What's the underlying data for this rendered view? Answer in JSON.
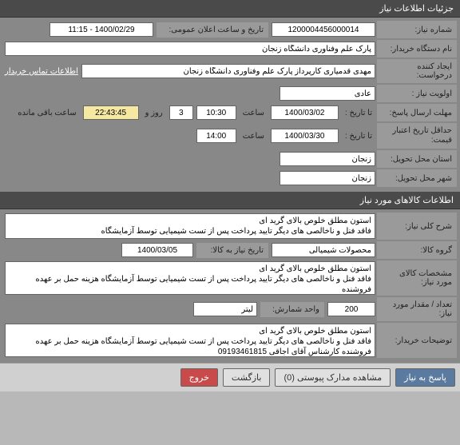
{
  "section1": {
    "header": "جزئیات اطلاعات نیاز",
    "rows": {
      "number_label": "شماره نیاز:",
      "number_value": "1200004456000014",
      "announce_label": "تاریخ و ساعت اعلان عمومی:",
      "announce_value": "1400/02/29 - 11:15",
      "buyer_label": "نام دستگاه خریدار:",
      "buyer_value": "پارک علم وفناوری دانشگاه زنجان",
      "creator_label": "ایجاد کننده درخواست:",
      "creator_value": "مهدی قدمیاری کارپرداز پارک علم وفناوری دانشگاه زنجان",
      "contact_link": "اطلاعات تماس خریدار",
      "priority_label": "اولویت نیاز :",
      "priority_value": "عادی",
      "deadline_label": "مهلت ارسال پاسخ:",
      "until_label": "تا تاریخ :",
      "until_date": "1400/03/02",
      "time_label": "ساعت",
      "until_time": "10:30",
      "days_value": "3",
      "days_label": "روز و",
      "remaining_time": "22:43:45",
      "remaining_label": "ساعت باقی مانده",
      "validity_label": "حداقل تاریخ اعتبار قیمت:",
      "validity_until_label": "تا تاریخ :",
      "validity_date": "1400/03/30",
      "validity_time": "14:00",
      "province_label": "استان محل تحویل:",
      "province_value": "زنجان",
      "city_label": "شهر محل تحویل:",
      "city_value": "زنجان"
    }
  },
  "section2": {
    "header": "اطلاعات کالاهای مورد نیاز",
    "rows": {
      "desc_label": "شرح کلی نیاز:",
      "desc_value": "استون مطلق خلوص بالای گرید ای\nفاقد فنل و ناخالصی های دیگر تایید پرداخت پس از تست شیمیایی توسط آزمایشگاه",
      "group_label": "گروه کالا:",
      "group_value": "محصولات شیمیالی",
      "group_date_label": "تاریخ نیاز به کالا:",
      "group_date_value": "1400/03/05",
      "spec_label": "مشخصات کالای مورد نیاز:",
      "spec_value": "استون مطلق خلوص بالای گرید ای\nفاقد فنل و ناخالصی های دیگر تایید پرداخت پس از تست شیمیایی توسط آزمایشگاه هزینه حمل بر عهده فروشنده",
      "qty_label": "تعداد / مقدار مورد نیاز:",
      "qty_value": "200",
      "unit_label": "واحد شمارش:",
      "unit_value": "لیتر",
      "notes_label": "توضیحات خریدار:",
      "notes_value": "استون مطلق خلوص بالای گرید ای\nفاقد فنل و ناخالصی های دیگر تایید پرداخت پس از تست شیمیایی توسط آزمایشگاه هزینه حمل بر عهده فروشنده کارشناس آقای اجاقی 09193461815"
    }
  },
  "footer": {
    "respond": "پاسخ به نیاز",
    "attachments": "مشاهده مدارک پیوستی (0)",
    "back": "بازگشت",
    "exit": "خروج"
  }
}
